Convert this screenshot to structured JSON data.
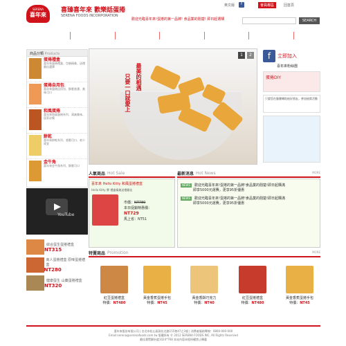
{
  "header": {
    "logo_en": "SERENA",
    "logo_zh": "喜年來",
    "slogan_main": "喜臻喜年來  歡樂話蛋捲",
    "slogan_sub": "SERENA FOODS INCORPORATION",
    "announcement": "歡迎光臨喜年來!蛋捲的第一品牌! 食品業的翹楚! 即日起選購",
    "links": [
      "英文版",
      "會員專區",
      "回首頁"
    ],
    "fb": "f",
    "search_placeholder": "",
    "search_label": "SEARCH"
  },
  "nav": {
    "items": [
      "關於喜年來",
      "線上購物網",
      "最新消息",
      "經銷據點",
      "產品FAQ",
      "活動專區",
      "Hello"
    ]
  },
  "sidebar": {
    "title": "商品分類",
    "title_en": "Products",
    "items": [
      {
        "name": "蛋捲禮盒",
        "desc": "喜年來蛋捲禮盒、包裝精美、送禮最佳選擇"
      },
      {
        "name": "蛋捲自用包",
        "desc": "喜年來蛋捲自用包、酥脆香濃、美味可口"
      },
      {
        "name": "和風蛋捲",
        "desc": "喜年來和風蛋捲系列、清爽美味、居家必備"
      },
      {
        "name": "餅乾",
        "desc": "喜年來餅乾系列、香脆可口、老少咸宜"
      },
      {
        "name": "金牛角",
        "desc": "喜年來金牛角系列、酥脆可口"
      }
    ]
  },
  "banner": {
    "vertical_text": [
      "最美的相遇",
      "只要一口就愛上"
    ],
    "pages": [
      "1",
      "2"
    ]
  },
  "right": {
    "fb_title": "立即加入",
    "fb_sub": "喜年來粉絲團",
    "box1_title": "蛋捲DIY",
    "box1_desc": "只要您在臉書轉貼給好朋友，參加抽獎活動"
  },
  "hot": {
    "title": "人氣商品",
    "title_en": "Hot Sale",
    "product": "喜年來 Hello Kitty 和風蛋捲禮盒",
    "product_desc": "Hello Kitty 牌 禮盒精美送禮最佳",
    "price_label": "市價：",
    "price_old": "NT780",
    "discount_label": "本日促銷特惠價：",
    "price": "NT729",
    "member_label": "馬上省：",
    "save": "NT51"
  },
  "news": {
    "title": "最新消息",
    "title_en": "Hot News",
    "more": "MORE",
    "tag": "NEWS",
    "items": [
      "歡迎光臨喜年來!蛋捲的第一品牌!食品業的翹楚!即日起購滿",
      "即享5000元運費，更享95折優惠",
      "歡迎光臨喜年來!蛋捲的第一品牌!食品業的翹楚!即日起購滿",
      "即享5000元運費，更享95折優惠"
    ]
  },
  "left_promos": [
    {
      "name": "綜合蛋生蛋捲禮盒",
      "price": "NT315"
    },
    {
      "name": "商人蛋捲禮盒 原味蛋捲禮盒",
      "price": "NT280"
    },
    {
      "name": "健康蛋生 山藥蛋捲禮盒",
      "price": "NT320"
    }
  ],
  "specials": {
    "title": "特賣商品",
    "title_en": "Promotion",
    "more": "MORE",
    "items": [
      {
        "name": "紅豆蛋捲禮盒",
        "price_label": "特價：",
        "price": "NT480"
      },
      {
        "name": "黃金香蕉蛋捲手包",
        "price_label": "特價：",
        "price": "NT45"
      },
      {
        "name": "黃金香酥巧克力",
        "price_label": "特價：",
        "price": "NT40"
      },
      {
        "name": "紅豆蛋捲禮盒",
        "price_label": "特價：",
        "price": "NT480"
      },
      {
        "name": "黃金香蕉蛋捲手包",
        "price_label": "特價：",
        "price": "NT45"
      }
    ]
  },
  "footer": {
    "line1": "喜年來股份有限公司 | 台北市松山區敦化北路155巷47之3號 | 消費者服務專線：0800-000-000",
    "line2": "Email:serena@serenafoods.com.tw  版權所有 © 2012 SERENA FOODS INC. All Rights Reserved",
    "line3": "最佳瀏覽解析度1024*768  本站內容未經授權禁止轉載"
  }
}
